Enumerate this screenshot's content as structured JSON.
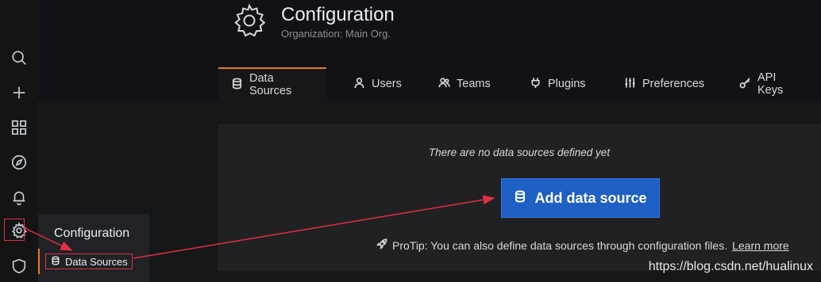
{
  "page": {
    "title": "Configuration",
    "subtitle": "Organization: Main Org."
  },
  "tabs": [
    {
      "label": "Data Sources",
      "icon": "database-icon",
      "active": true
    },
    {
      "label": "Users",
      "icon": "user-icon"
    },
    {
      "label": "Teams",
      "icon": "users-icon"
    },
    {
      "label": "Plugins",
      "icon": "plug-icon"
    },
    {
      "label": "Preferences",
      "icon": "sliders-icon"
    },
    {
      "label": "API Keys",
      "icon": "key-icon"
    }
  ],
  "empty_state": {
    "message": "There are no data sources defined yet",
    "button_label": "Add data source",
    "protip_text": "ProTip: You can also define data sources through configuration files.",
    "protip_link": "Learn more"
  },
  "sidebar": {
    "icons": [
      "search-icon",
      "plus-icon",
      "dashboards-icon",
      "explore-icon",
      "alerting-icon",
      "gear-icon",
      "shield-icon"
    ]
  },
  "flyout": {
    "title": "Configuration",
    "item_label": "Data Sources"
  },
  "watermark": "https://blog.csdn.net/hualinux",
  "colors": {
    "accent_orange": "#eb7b18",
    "primary_blue": "#1f60c4",
    "annotation_red": "#e02f44"
  }
}
